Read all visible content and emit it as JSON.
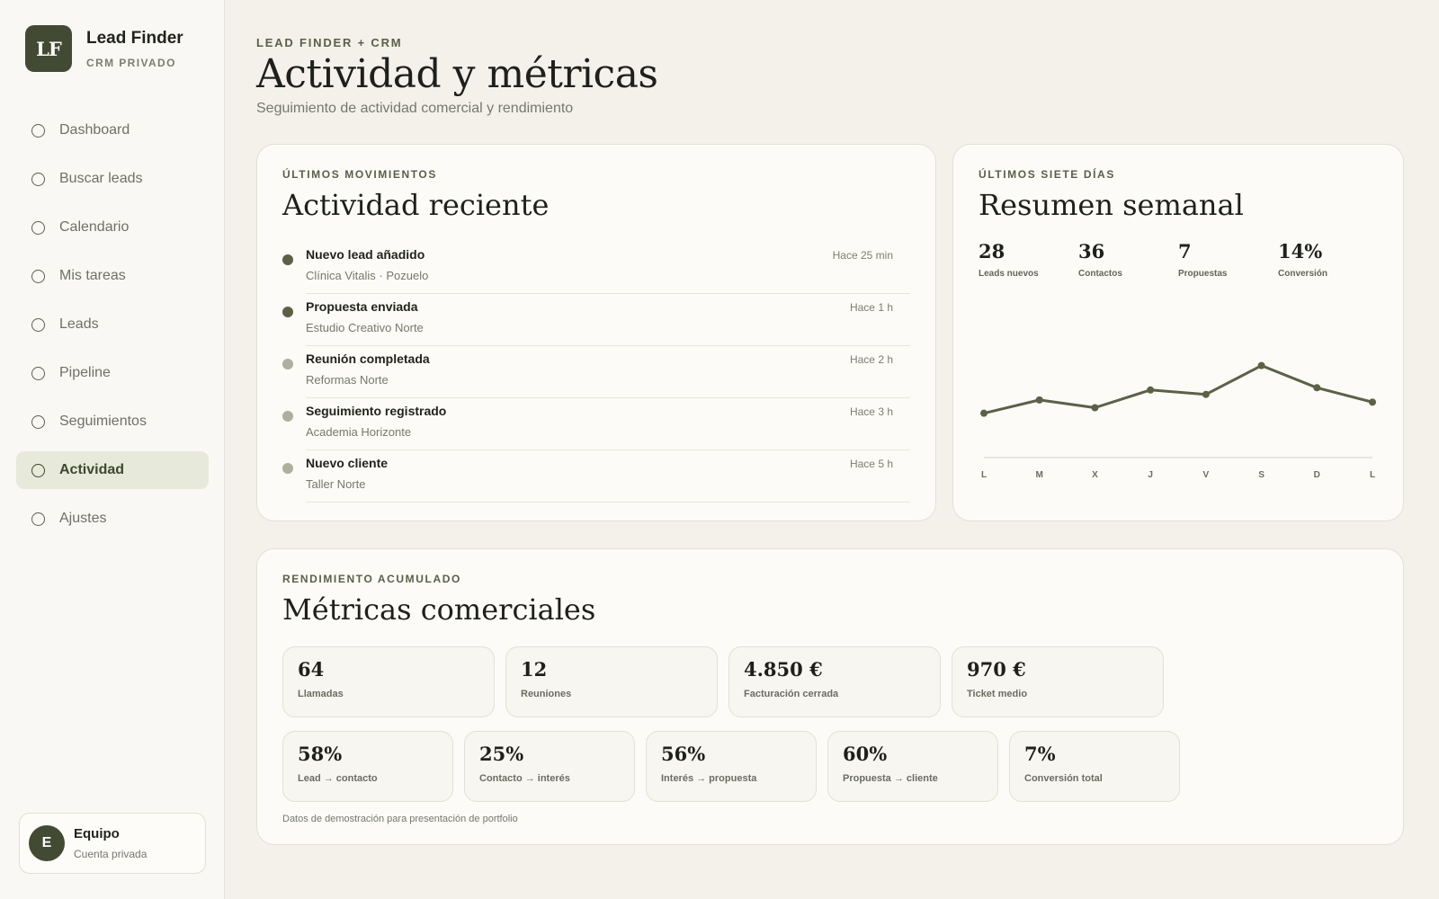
{
  "brand": {
    "logo": "LF",
    "title": "Lead Finder",
    "subtitle": "CRM PRIVADO"
  },
  "sidebar": {
    "items": [
      {
        "label": "Dashboard",
        "icon": "circle-icon",
        "active": false
      },
      {
        "label": "Buscar leads",
        "icon": "circle-icon",
        "active": false
      },
      {
        "label": "Calendario",
        "icon": "circle-icon",
        "active": false
      },
      {
        "label": "Mis tareas",
        "icon": "circle-icon",
        "active": false
      },
      {
        "label": "Leads",
        "icon": "circle-icon",
        "active": false
      },
      {
        "label": "Pipeline",
        "icon": "circle-icon",
        "active": false
      },
      {
        "label": "Seguimientos",
        "icon": "circle-icon",
        "active": false
      },
      {
        "label": "Actividad",
        "icon": "circle-icon",
        "active": true
      },
      {
        "label": "Ajustes",
        "icon": "circle-icon",
        "active": false
      }
    ],
    "team": {
      "initial": "E",
      "name": "Equipo",
      "sub": "Cuenta privada"
    }
  },
  "header": {
    "eyebrow": "LEAD FINDER + CRM",
    "title": "Actividad y métricas",
    "subtitle": "Seguimiento de actividad comercial y rendimiento"
  },
  "activity": {
    "eyebrow": "ÚLTIMOS MOVIMIENTOS",
    "title": "Actividad reciente",
    "items": [
      {
        "title": "Nuevo lead añadido",
        "sub": "Clínica Vitalis · Pozuelo",
        "time": "Hace 25 min",
        "dot": "#5b6145"
      },
      {
        "title": "Propuesta enviada",
        "sub": "Estudio Creativo Norte",
        "time": "Hace 1 h",
        "dot": "#5b6145"
      },
      {
        "title": "Reunión completada",
        "sub": "Reformas Norte",
        "time": "Hace 2 h",
        "dot": "#adb09c"
      },
      {
        "title": "Seguimiento registrado",
        "sub": "Academia Horizonte",
        "time": "Hace 3 h",
        "dot": "#adb09c"
      },
      {
        "title": "Nuevo cliente",
        "sub": "Taller Norte",
        "time": "Hace 5 h",
        "dot": "#adb09c"
      }
    ]
  },
  "weekly": {
    "eyebrow": "ÚLTIMOS SIETE DÍAS",
    "title": "Resumen semanal",
    "stats": [
      {
        "value": "28",
        "label": "Leads nuevos"
      },
      {
        "value": "36",
        "label": "Contactos"
      },
      {
        "value": "7",
        "label": "Propuestas"
      },
      {
        "value": "14%",
        "label": "Conversión"
      }
    ]
  },
  "chart_data": {
    "type": "line",
    "categories": [
      "L",
      "M",
      "X",
      "J",
      "V",
      "S",
      "D",
      "L"
    ],
    "values": [
      4,
      5.2,
      4.5,
      6.1,
      5.7,
      8.3,
      6.3,
      5.0
    ],
    "ylim": [
      0,
      12
    ],
    "grid": false,
    "color": "#5b6145"
  },
  "metrics": {
    "eyebrow": "RENDIMIENTO ACUMULADO",
    "title": "Métricas comerciales",
    "row1": [
      {
        "value": "64",
        "label": "Llamadas"
      },
      {
        "value": "12",
        "label": "Reuniones"
      },
      {
        "value": "4.850 €",
        "label": "Facturación cerrada"
      },
      {
        "value": "970 €",
        "label": "Ticket medio"
      }
    ],
    "row2": [
      {
        "value": "58%",
        "label": "Lead → contacto"
      },
      {
        "value": "25%",
        "label": "Contacto → interés"
      },
      {
        "value": "56%",
        "label": "Interés → propuesta"
      },
      {
        "value": "60%",
        "label": "Propuesta → cliente"
      },
      {
        "value": "7%",
        "label": "Conversión total"
      }
    ],
    "note": "Datos de demostración para presentación de portfolio"
  }
}
